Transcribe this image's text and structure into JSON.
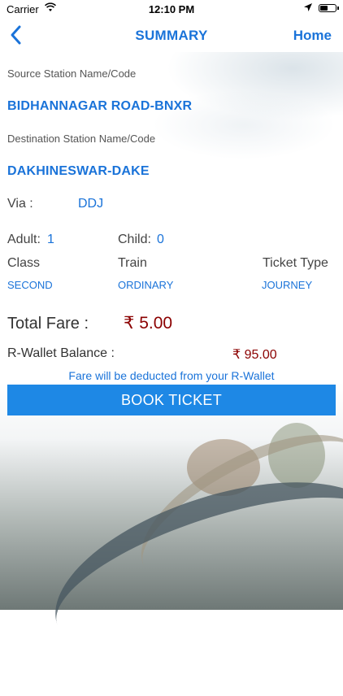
{
  "status": {
    "carrier": "Carrier",
    "time": "12:10 PM"
  },
  "nav": {
    "title": "SUMMARY",
    "home_label": "Home"
  },
  "source": {
    "label": "Source Station Name/Code",
    "value": "BIDHANNAGAR ROAD-BNXR"
  },
  "destination": {
    "label": "Destination Station Name/Code",
    "value": "DAKHINESWAR-DAKE"
  },
  "via": {
    "label": "Via :",
    "value": "DDJ"
  },
  "passengers": {
    "adult_label": "Adult:",
    "adult_value": "1",
    "child_label": "Child:",
    "child_value": "0"
  },
  "details": {
    "class_label": "Class",
    "class_value": "SECOND",
    "train_label": "Train",
    "train_value": "ORDINARY",
    "ticket_type_label": "Ticket Type",
    "ticket_type_value": "JOURNEY"
  },
  "fare": {
    "label": "Total Fare :",
    "value": "₹ 5.00"
  },
  "wallet": {
    "label": "R-Wallet Balance :",
    "value": "₹ 95.00"
  },
  "note": "Fare will be deducted from your R-Wallet",
  "book_button": "BOOK TICKET",
  "colors": {
    "accent": "#1a73d9",
    "button": "#1e88e5",
    "fare": "#8b0000"
  }
}
